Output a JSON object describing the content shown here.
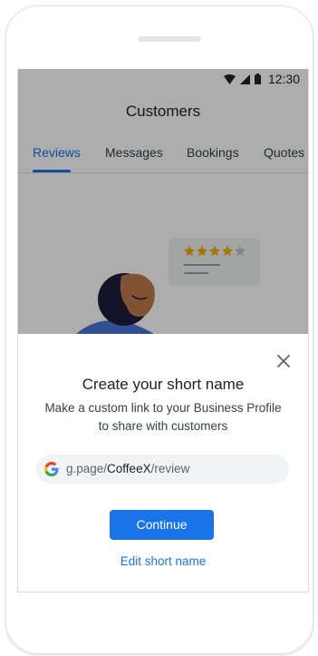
{
  "status_bar": {
    "time": "12:30",
    "icons": [
      "wifi-icon",
      "signal-icon",
      "battery-icon"
    ]
  },
  "app_bar": {
    "title": "Customers"
  },
  "tabs": [
    {
      "label": "Reviews",
      "active": true
    },
    {
      "label": "Messages",
      "active": false
    },
    {
      "label": "Bookings",
      "active": false
    },
    {
      "label": "Quotes",
      "active": false
    }
  ],
  "illustration": {
    "stars_filled": 4,
    "stars_total": 5
  },
  "dialog": {
    "title": "Create your short name",
    "body": "Make a custom link to your Business Profile to share with customers",
    "link": {
      "prefix": "g.page/",
      "name": "CoffeeX",
      "suffix": "/review"
    },
    "continue_label": "Continue",
    "edit_label": "Edit short name"
  },
  "colors": {
    "accent": "#1a73e8",
    "star": "#f9ab00",
    "scrim": "rgba(0,0,0,0.32)"
  }
}
